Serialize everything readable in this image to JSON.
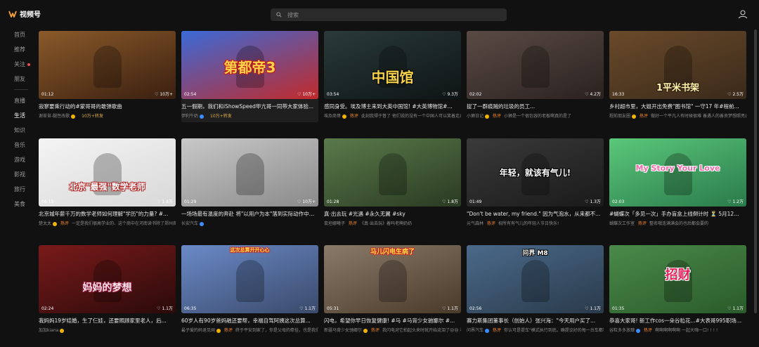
{
  "app": {
    "title": "视频号"
  },
  "search": {
    "placeholder": "搜索"
  },
  "sidebar": {
    "items": [
      {
        "label": "首页",
        "active": false,
        "dot": false
      },
      {
        "label": "推荐",
        "active": false,
        "dot": false
      },
      {
        "label": "关注",
        "active": false,
        "dot": true
      },
      {
        "label": "朋友",
        "active": false,
        "dot": false
      },
      {
        "label": "直播",
        "active": false,
        "dot": false
      },
      {
        "label": "生活",
        "active": true,
        "dot": false
      },
      {
        "label": "知识",
        "active": false,
        "dot": false
      },
      {
        "label": "音乐",
        "active": false,
        "dot": false
      },
      {
        "label": "游戏",
        "active": false,
        "dot": false
      },
      {
        "label": "影视",
        "active": false,
        "dot": false
      },
      {
        "label": "旅行",
        "active": false,
        "dot": false
      },
      {
        "label": "美食",
        "active": false,
        "dot": false
      }
    ]
  },
  "videos": [
    {
      "duration": "01:12",
      "likes": "10万+",
      "title": "寂寥要乘行动的#蒙哥哥的敢弹歌曲",
      "author": "谢苔苔-腿性改歌",
      "hot": "",
      "stat": "10万+转发",
      "badge": "yellow",
      "colors": [
        "#8a5a2a",
        "#3a1f10"
      ],
      "overlay": ""
    },
    {
      "duration": "02:54",
      "likes": "10万+",
      "title": "五一假期，我们和iShowSpeed甲亢哥一同带大家体验...",
      "author": "伊利牛奶",
      "hot": "",
      "stat": "10万+转发",
      "badge": "blue",
      "colors": [
        "#3a6ad8",
        "#c22a2a"
      ],
      "overlay": "第都帝3"
    },
    {
      "duration": "03:54",
      "likes": "9.3万",
      "title": "感同身受。埃及博主来到大英中国馆! #大英博物馆#...",
      "author": "埃及商哥",
      "hot": "热评",
      "stat": "此刻我得于督了 他们说的没有一个中国人可以笑着走出大...",
      "badge": "yellow",
      "colors": [
        "#2a3a3a",
        "#0e1414"
      ],
      "overlay": "中国馆"
    },
    {
      "duration": "02:02",
      "likes": "4.2万",
      "title": "捉了一群痕贼的垃圾的员工...",
      "author": "小狮日记",
      "hot": "热评",
      "stat": "小狮是一个很包容的老板啊真的是了",
      "badge": "yellow",
      "colors": [
        "#5a4a44",
        "#2a2220"
      ],
      "overlay": ""
    },
    {
      "duration": "16:33",
      "likes": "2.5万",
      "title": "乡村超市里，大姐开出免费\"图书馆\" 一守17 年#程前...",
      "author": "程前朋友圈",
      "hot": "热评",
      "stat": "做好一个平凡人有时候很难 善遇人的善良梦想照亮自己光...",
      "badge": "yellow",
      "colors": [
        "#6a4a2a",
        "#3a2a1a"
      ],
      "overlay": "1平米书架"
    },
    {
      "duration": "06:15",
      "likes": "1.8万",
      "title": "北京城年薪千万的数学老师如何理解\"学历\"的力量? #...",
      "author": "楚太太",
      "hot": "热评",
      "stat": "一定是我们很高学业的、这个商中在河南读书除了郑州商...",
      "badge": "yellow",
      "colors": [
        "#f4f4f4",
        "#d8d8d8"
      ],
      "overlay": "北京\"最强\"数学老师"
    },
    {
      "duration": "01:29",
      "likes": "10万+",
      "title": "一场场最有温度的奔赴 将\"以用户为本\"落到实际动作中...",
      "author": "长安汽车",
      "hot": "",
      "stat": "",
      "badge": "blue",
      "colors": [
        "#c8c8c8",
        "#8a8a8a"
      ],
      "overlay": ""
    },
    {
      "duration": "01:28",
      "likes": "1.8万",
      "title": "真·出去玩 #光遇 #永久无翼 #sky",
      "author": "鼠坦娜曦子",
      "hot": "热评",
      "stat": "《真·出去玩》着吗老啊奶奶",
      "badge": "",
      "colors": [
        "#5a7a4a",
        "#2a3a22"
      ],
      "overlay": ""
    },
    {
      "duration": "01:49",
      "likes": "1.3万",
      "title": "\"Don't be water, my friend.\" 因为气泡水，从来都不...",
      "author": "元气森林",
      "hot": "热评",
      "stat": "祝所有有气儿的年轻人节日快乐!",
      "badge": "",
      "colors": [
        "#3a3a3a",
        "#1a1a1a"
      ],
      "overlay": "年轻，就该有气儿!"
    },
    {
      "duration": "02:03",
      "likes": "1.2万",
      "title": "#蝴蝶次「多见一次」手办盲盒上线倒计时 ⏳ 5月12...",
      "author": "蝴蝶次工作室",
      "hot": "热评",
      "stat": "整名哦连满满会的也后都会要的",
      "badge": "",
      "colors": [
        "#5ac87a",
        "#2a7a4a"
      ],
      "overlay": "My Story Your Love"
    },
    {
      "duration": "02:24",
      "likes": "1.1万",
      "title": "我妈妈19岁结婚，生了仨娃，还要照顾家里老人，后...",
      "author": "加加kiana",
      "hot": "",
      "stat": "",
      "badge": "yellow",
      "colors": [
        "#7a1a1a",
        "#2a0a0a"
      ],
      "overlay": "妈妈的梦想"
    },
    {
      "duration": "06:35",
      "likes": "1.1万",
      "title": "60岁人有90岁爸妈融还要帮，幸福自驾阿姨这次总算...",
      "author": "最子爱的妈退见闻",
      "hot": "热评",
      "stat": "终于平安到家了，你是父母的牵挂，也是我们追过我们的...",
      "badge": "yellow",
      "colors": [
        "#6a8ac8",
        "#3a4a6a"
      ],
      "overlay": "这次总算开开心心"
    },
    {
      "duration": "05:31",
      "likes": "1.1万",
      "title": "闪电，希望你早日恢复健康! #马 #马背少女驰娜尔 #...",
      "author": "新疆马背少女驰娜尔",
      "hot": "热评",
      "stat": "我闪电对它拍起头来时就开始流泪了😢😢 希望闪电早点好...",
      "badge": "yellow",
      "colors": [
        "#8a7a6a",
        "#4a3a2a"
      ],
      "overlay": "马儿闪电生病了"
    },
    {
      "duration": "02:56",
      "likes": "1.1万",
      "title": "赛力斯集团董事长（创始人）张兴海：\"今天用户买了...",
      "author": "问界汽车",
      "hot": "热评",
      "stat": "你认可是提车\"模式执行到底。确提议好的每一台车都符合...",
      "badge": "blue",
      "colors": [
        "#4a6a8a",
        "#2a3a4a"
      ],
      "overlay": "问界 M8"
    },
    {
      "duration": "01:35",
      "likes": "1.1万",
      "title": "恭喜大家哥! 新工作cos一朵谷粒花...#大表哥995职场...",
      "author": "谷粒多多放肆",
      "hot": "热评",
      "stat": "啊啊啊啊啊啊 一起大嗨一口! ! ! !",
      "badge": "blue",
      "colors": [
        "#4a8a4a",
        "#2a5a2a"
      ],
      "overlay": "招财"
    }
  ]
}
